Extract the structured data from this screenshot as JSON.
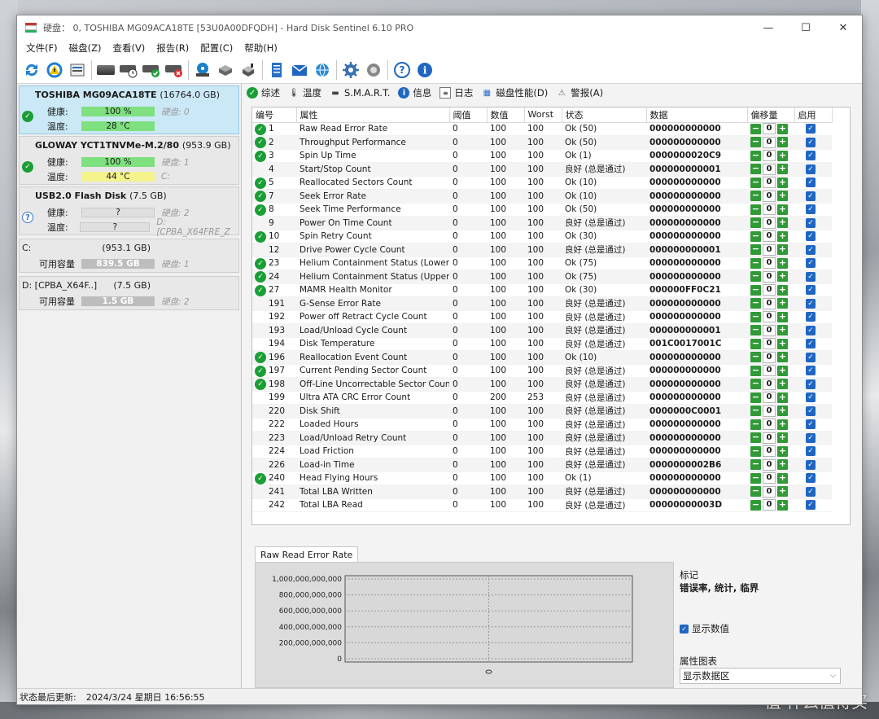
{
  "window": {
    "title": "硬盘： 0, TOSHIBA MG09ACA18TE [53U0A00DFQDH]  -  Hard Disk Sentinel 6.10 PRO",
    "minimize": "—",
    "maximize": "☐",
    "close": "✕"
  },
  "menu": [
    "文件(F)",
    "磁盘(Z)",
    "查看(V)",
    "报告(R)",
    "配置(C)",
    "帮助(H)"
  ],
  "disks": [
    {
      "name": "TOSHIBA MG09ACA18TE",
      "size": "(16764.0 GB)",
      "health_label": "健康:",
      "health": "100 %",
      "health_pct": 1.0,
      "temp_label": "温度:",
      "temp": "28 °C",
      "extra1": "硬盘: 0",
      "extra2": "",
      "status": "ok"
    },
    {
      "name": "GLOWAY YCT1TNVMe-M.2/80",
      "size": "(953.9 GB)",
      "health_label": "健康:",
      "health": "100 %",
      "health_pct": 1.0,
      "temp_label": "温度:",
      "temp": "44 °C",
      "extra1": "硬盘: 1",
      "extra2": "C:",
      "status": "ok"
    },
    {
      "name": "USB2.0  Flash Disk",
      "size": "(7.5 GB)",
      "health_label": "健康:",
      "health": "?",
      "health_pct": 0,
      "temp_label": "温度:",
      "temp": "?",
      "extra1": "硬盘: 2",
      "extra2": "D: [CPBA_X64FRE_Z",
      "status": "unknown"
    }
  ],
  "volumes": [
    {
      "name": "C:",
      "size": "(953.1 GB)",
      "label": "可用容量",
      "free": "839.5 GB",
      "free_pct": 0.88,
      "disk": "硬盘: 1"
    },
    {
      "name": "D: [CPBA_X64F..]",
      "size": "(7.5 GB)",
      "label": "可用容量",
      "free": "1.5 GB",
      "free_pct": 0.2,
      "disk": "硬盘: 2"
    }
  ],
  "tabs": [
    "综述",
    "温度",
    "S.M.A.R.T.",
    "信息",
    "日志",
    "磁盘性能(D)",
    "警报(A)"
  ],
  "smart_columns": [
    "编号",
    "属性",
    "阈值",
    "数值",
    "Worst",
    "状态",
    "数据",
    "偏移量",
    "启用"
  ],
  "smart_rows": [
    {
      "id": "1",
      "attr": "Raw Read Error Rate",
      "thr": "0",
      "val": "100",
      "worst": "100",
      "status": "Ok (50)",
      "data": "000000000000",
      "ok": true
    },
    {
      "id": "2",
      "attr": "Throughput Performance",
      "thr": "0",
      "val": "100",
      "worst": "100",
      "status": "Ok (50)",
      "data": "000000000000",
      "ok": true
    },
    {
      "id": "3",
      "attr": "Spin Up Time",
      "thr": "0",
      "val": "100",
      "worst": "100",
      "status": "Ok (1)",
      "data": "0000000020C9",
      "ok": true
    },
    {
      "id": "4",
      "attr": "Start/Stop Count",
      "thr": "0",
      "val": "100",
      "worst": "100",
      "status": "良好 (总是通过)",
      "data": "000000000001",
      "ok": false
    },
    {
      "id": "5",
      "attr": "Reallocated Sectors Count",
      "thr": "0",
      "val": "100",
      "worst": "100",
      "status": "Ok (10)",
      "data": "000000000000",
      "ok": true
    },
    {
      "id": "7",
      "attr": "Seek Error Rate",
      "thr": "0",
      "val": "100",
      "worst": "100",
      "status": "Ok (10)",
      "data": "000000000000",
      "ok": true
    },
    {
      "id": "8",
      "attr": "Seek Time Performance",
      "thr": "0",
      "val": "100",
      "worst": "100",
      "status": "Ok (50)",
      "data": "000000000000",
      "ok": true
    },
    {
      "id": "9",
      "attr": "Power On Time Count",
      "thr": "0",
      "val": "100",
      "worst": "100",
      "status": "良好 (总是通过)",
      "data": "000000000000",
      "ok": false
    },
    {
      "id": "10",
      "attr": "Spin Retry Count",
      "thr": "0",
      "val": "100",
      "worst": "100",
      "status": "Ok (30)",
      "data": "000000000000",
      "ok": true
    },
    {
      "id": "12",
      "attr": "Drive Power Cycle Count",
      "thr": "0",
      "val": "100",
      "worst": "100",
      "status": "良好 (总是通过)",
      "data": "000000000001",
      "ok": false
    },
    {
      "id": "23",
      "attr": "Helium Containment Status (Lower)",
      "thr": "0",
      "val": "100",
      "worst": "100",
      "status": "Ok (75)",
      "data": "000000000000",
      "ok": true
    },
    {
      "id": "24",
      "attr": "Helium Containment Status (Upper)",
      "thr": "0",
      "val": "100",
      "worst": "100",
      "status": "Ok (75)",
      "data": "000000000000",
      "ok": true
    },
    {
      "id": "27",
      "attr": "MAMR Health Monitor",
      "thr": "0",
      "val": "100",
      "worst": "100",
      "status": "Ok (30)",
      "data": "000000FF0C21",
      "ok": true
    },
    {
      "id": "191",
      "attr": "G-Sense Error Rate",
      "thr": "0",
      "val": "100",
      "worst": "100",
      "status": "良好 (总是通过)",
      "data": "000000000000",
      "ok": false
    },
    {
      "id": "192",
      "attr": "Power off Retract Cycle Count",
      "thr": "0",
      "val": "100",
      "worst": "100",
      "status": "良好 (总是通过)",
      "data": "000000000000",
      "ok": false
    },
    {
      "id": "193",
      "attr": "Load/Unload Cycle Count",
      "thr": "0",
      "val": "100",
      "worst": "100",
      "status": "良好 (总是通过)",
      "data": "000000000001",
      "ok": false
    },
    {
      "id": "194",
      "attr": "Disk Temperature",
      "thr": "0",
      "val": "100",
      "worst": "100",
      "status": "良好 (总是通过)",
      "data": "001C0017001C",
      "ok": false
    },
    {
      "id": "196",
      "attr": "Reallocation Event Count",
      "thr": "0",
      "val": "100",
      "worst": "100",
      "status": "Ok (10)",
      "data": "000000000000",
      "ok": true
    },
    {
      "id": "197",
      "attr": "Current Pending Sector Count",
      "thr": "0",
      "val": "100",
      "worst": "100",
      "status": "良好 (总是通过)",
      "data": "000000000000",
      "ok": true
    },
    {
      "id": "198",
      "attr": "Off-Line Uncorrectable Sector Count",
      "thr": "0",
      "val": "100",
      "worst": "100",
      "status": "良好 (总是通过)",
      "data": "000000000000",
      "ok": true
    },
    {
      "id": "199",
      "attr": "Ultra ATA CRC Error Count",
      "thr": "0",
      "val": "200",
      "worst": "253",
      "status": "良好 (总是通过)",
      "data": "000000000000",
      "ok": false
    },
    {
      "id": "220",
      "attr": "Disk Shift",
      "thr": "0",
      "val": "100",
      "worst": "100",
      "status": "良好 (总是通过)",
      "data": "0000000C0001",
      "ok": false
    },
    {
      "id": "222",
      "attr": "Loaded Hours",
      "thr": "0",
      "val": "100",
      "worst": "100",
      "status": "良好 (总是通过)",
      "data": "000000000000",
      "ok": false
    },
    {
      "id": "223",
      "attr": "Load/Unload Retry Count",
      "thr": "0",
      "val": "100",
      "worst": "100",
      "status": "良好 (总是通过)",
      "data": "000000000000",
      "ok": false
    },
    {
      "id": "224",
      "attr": "Load Friction",
      "thr": "0",
      "val": "100",
      "worst": "100",
      "status": "良好 (总是通过)",
      "data": "000000000000",
      "ok": false
    },
    {
      "id": "226",
      "attr": "Load-in Time",
      "thr": "0",
      "val": "100",
      "worst": "100",
      "status": "良好 (总是通过)",
      "data": "0000000002B6",
      "ok": false
    },
    {
      "id": "240",
      "attr": "Head Flying Hours",
      "thr": "0",
      "val": "100",
      "worst": "100",
      "status": "Ok (1)",
      "data": "000000000000",
      "ok": true
    },
    {
      "id": "241",
      "attr": "Total LBA Written",
      "thr": "0",
      "val": "100",
      "worst": "100",
      "status": "良好 (总是通过)",
      "data": "000000000000",
      "ok": false
    },
    {
      "id": "242",
      "attr": "Total LBA Read",
      "thr": "0",
      "val": "100",
      "worst": "100",
      "status": "良好 (总是通过)",
      "data": "00000000003D",
      "ok": false
    }
  ],
  "offset_value": "0",
  "graph": {
    "tab_label": "Raw Read Error Rate",
    "y_ticks": [
      "1,000,000,000,000",
      "800,000,000,000",
      "600,000,000,000",
      "400,000,000,000",
      "200,000,000,000",
      "0"
    ]
  },
  "legend": {
    "title": "标记",
    "value": "错误率, 统计, 临界",
    "show_values_label": "显示数值",
    "attr_chart_label": "属性图表",
    "select_value": "显示数据区"
  },
  "status_bar": {
    "label": "状态最后更新:",
    "value": "2024/3/24 星期日 16:56:55"
  },
  "watermark": "值 什么值得买",
  "colors": {
    "ok_green": "#1a9e36",
    "accent_blue": "#1f66c2",
    "selected_disk": "#cbe8f6"
  }
}
